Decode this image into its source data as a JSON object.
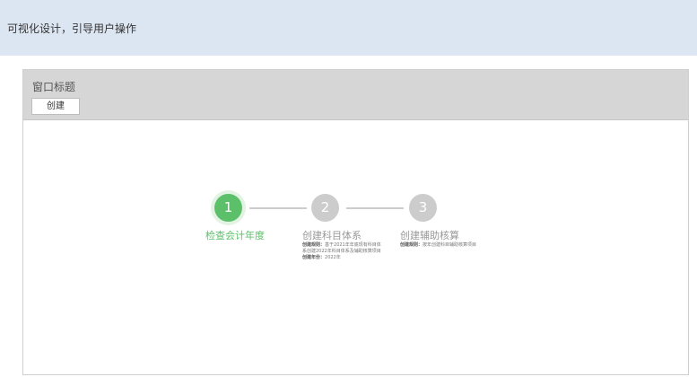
{
  "banner": {
    "title": "可视化设计，引导用户操作"
  },
  "window": {
    "title": "窗口标题",
    "create_button": "创建"
  },
  "steps": [
    {
      "number": "1",
      "title": "检查会计年度",
      "status": "active",
      "desc": []
    },
    {
      "number": "2",
      "title": "创建科目体系",
      "status": "inactive",
      "desc": [
        {
          "label": "创建规则：",
          "text": "基于2021年年底现有科目体"
        },
        {
          "label": "",
          "text": "系创建2022年科目体系及辅助核算项目"
        },
        {
          "label": "创建年份：",
          "text": "2022年"
        }
      ]
    },
    {
      "number": "3",
      "title": "创建辅助核算",
      "status": "inactive",
      "desc": [
        {
          "label": "创建规则：",
          "text": "按年创建科目辅助核算项目"
        }
      ]
    }
  ],
  "colors": {
    "active": "#5cbf69",
    "inactive": "#cccccc",
    "banner_bg": "#dce6f2",
    "header_bg": "#d6d6d6"
  }
}
